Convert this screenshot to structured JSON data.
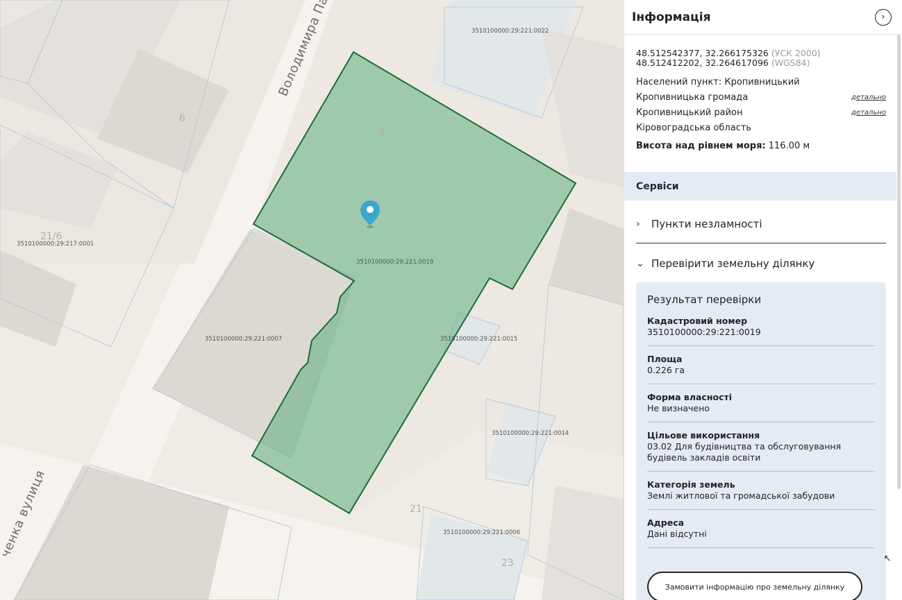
{
  "map": {
    "street_1": "Володимира Па",
    "street_2": "ченка вулиця",
    "house_numbers": {
      "h6": "6",
      "h8": "8",
      "h21": "21",
      "h23": "23",
      "h21_6": "21/6"
    },
    "plots": {
      "p0022": "3510100000:29:221:0022",
      "p0001": "3510100000:29:217:0001",
      "p0019": "3510100000:29:221:0019",
      "p0007": "3510100000:29:221:0007",
      "p0015": "3510100000:29:221:0015",
      "p0014": "3510100000:29:221:0014",
      "p0006": "3510100000:29:221:0006"
    },
    "selected_fill": "#5fae80",
    "selected_stroke": "#1c6b33",
    "pin_color": "#3aa8cc"
  },
  "panel": {
    "title": "Інформація",
    "coords": {
      "line1_value": "48.512542377, 32.266175326",
      "line1_system": "(УСК 2000)",
      "line2_value": "48.512412202, 32.264617096",
      "line2_system": "(WGS84)"
    },
    "settlement": "Населений пункт: Кропивницький",
    "community": "Кропивницька громада",
    "district": "Кропивницький район",
    "region": "Кіровоградська область",
    "detail_link": "детально",
    "altitude_label": "Висота над рівнем моря:",
    "altitude_value": "116.00 м",
    "services_title": "Сервіси",
    "accordion_1": "Пункти незламності",
    "accordion_2": "Перевірити земельну ділянку",
    "result": {
      "title": "Результат перевірки",
      "fields": [
        {
          "label": "Кадастровий номер",
          "value": "3510100000:29:221:0019"
        },
        {
          "label": "Площа",
          "value": "0.226 га"
        },
        {
          "label": "Форма власності",
          "value": "Не визначено"
        },
        {
          "label": "Цільове використання",
          "value": "03.02 Для будівництва та обслуговування будівель закладів освіти"
        },
        {
          "label": "Категорія земель",
          "value": "Землі житлової та громадської забудови"
        },
        {
          "label": "Адреса",
          "value": "Дані відсутні"
        }
      ]
    },
    "order_button": "Замовити інформацію про земельну ділянку"
  }
}
